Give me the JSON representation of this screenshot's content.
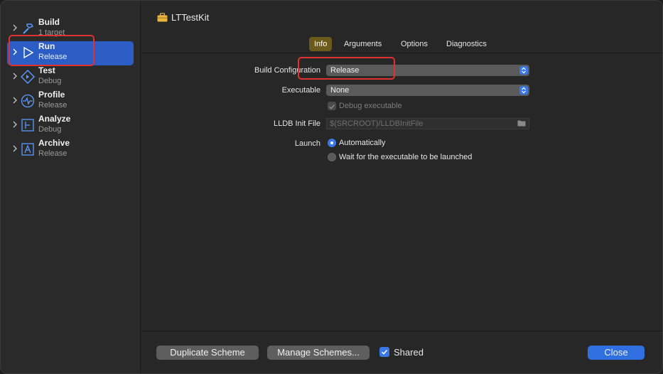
{
  "sidebar": {
    "items": [
      {
        "title": "Build",
        "subtitle": "1 target",
        "icon": "hammer-icon"
      },
      {
        "title": "Run",
        "subtitle": "Release",
        "icon": "play-icon"
      },
      {
        "title": "Test",
        "subtitle": "Debug",
        "icon": "diamond-icon"
      },
      {
        "title": "Profile",
        "subtitle": "Release",
        "icon": "waveform-icon"
      },
      {
        "title": "Analyze",
        "subtitle": "Debug",
        "icon": "analyze-icon"
      },
      {
        "title": "Archive",
        "subtitle": "Release",
        "icon": "archive-icon"
      }
    ],
    "selected_index": 1
  },
  "header": {
    "scheme_name": "LTTestKit",
    "scheme_icon": "toolbox-icon"
  },
  "tabs": [
    {
      "label": "Info",
      "active": true
    },
    {
      "label": "Arguments",
      "active": false
    },
    {
      "label": "Options",
      "active": false
    },
    {
      "label": "Diagnostics",
      "active": false
    }
  ],
  "form": {
    "build_configuration": {
      "label": "Build Configuration",
      "value": "Release"
    },
    "executable": {
      "label": "Executable",
      "value": "None"
    },
    "debug_executable": {
      "label": "Debug executable",
      "checked": true,
      "enabled": false
    },
    "lldb_init_file": {
      "label": "LLDB Init File",
      "placeholder": "$(SRCROOT)/LLDBInitFile",
      "icon": "folder-icon"
    },
    "launch": {
      "label": "Launch",
      "options": [
        {
          "label": "Automatically",
          "selected": true
        },
        {
          "label": "Wait for the executable to be launched",
          "selected": false
        }
      ]
    }
  },
  "footer": {
    "duplicate_label": "Duplicate Scheme",
    "manage_label": "Manage Schemes...",
    "shared_label": "Shared",
    "shared_checked": true,
    "close_label": "Close"
  },
  "colors": {
    "accent": "#2f6fe0",
    "selected_row": "#2c5dc4",
    "active_tab": "#6b5a1c",
    "highlight_box": "#e03030"
  }
}
